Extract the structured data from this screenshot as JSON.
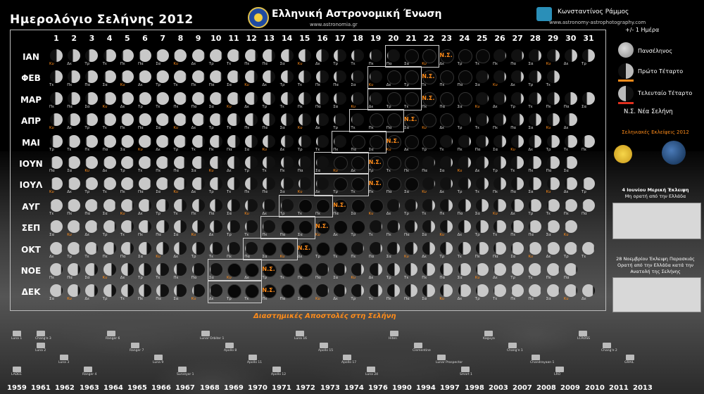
{
  "header": {
    "title": "Ημερολόγιο Σελήνης 2012",
    "org": "Ελληνική Αστρονομική Ένωση",
    "org_url": "www.astronomia.gr",
    "author": "Κωνσταντίνος Ράμμος",
    "author_url": "www.astronomy-astrophotography.com"
  },
  "months": [
    "ΙΑΝ",
    "ΦΕΒ",
    "ΜΑΡ",
    "ΑΠΡ",
    "ΜΑΙ",
    "ΙΟΥΝ",
    "ΙΟΥΛ",
    "ΑΥΓ",
    "ΣΕΠ",
    "ΟΚΤ",
    "ΝΟΕ",
    "ΔΕΚ"
  ],
  "days": [
    "1",
    "2",
    "3",
    "4",
    "5",
    "6",
    "7",
    "8",
    "9",
    "10",
    "11",
    "12",
    "13",
    "14",
    "15",
    "16",
    "17",
    "18",
    "19",
    "20",
    "21",
    "22",
    "23",
    "24",
    "25",
    "26",
    "27",
    "28",
    "29",
    "30",
    "31"
  ],
  "weekday_names": [
    "Κυ",
    "Δε",
    "Τρ",
    "Τε",
    "Πε",
    "Πα",
    "Σα"
  ],
  "month_lengths": [
    31,
    29,
    31,
    30,
    31,
    30,
    31,
    31,
    30,
    31,
    30,
    31
  ],
  "first_weekday": [
    0,
    3,
    4,
    0,
    2,
    5,
    0,
    3,
    6,
    1,
    4,
    6
  ],
  "new_moon_day": [
    23,
    22,
    22,
    21,
    20,
    19,
    19,
    17,
    16,
    15,
    13,
    13
  ],
  "new_moon_label": "Ν.Σ.",
  "legend": {
    "plus_minus": "+/- 1 Ημέρα",
    "full": "Πανσέληνος",
    "first_quarter": "Πρώτο Τέταρτο",
    "last_quarter": "Τελευταίο Τέταρτο",
    "new_moon": "Ν.Σ.  Νέα Σελήνη"
  },
  "eclipses": {
    "title": "Σεληνιακές Εκλείψεις  2012",
    "june_caption_1": "4 Ιουνίου Μερική Έκλειψη",
    "june_caption_2": "Μη ορατή από την Ελλάδα",
    "nov_caption_1": "28 Νοεμβρίου Έκλειψη Παρασκιάς",
    "nov_caption_2": "Ορατή από την Ελλάδα κατά την",
    "nov_caption_3": "Ανατολή της Σελήνης"
  },
  "missions": {
    "title": "Διαστημικές Αποστολές στη Σελήνη",
    "years": [
      "1959",
      "1961",
      "1962",
      "1963",
      "1964",
      "1965",
      "1966",
      "1967",
      "1968",
      "1969",
      "1970",
      "1971",
      "1972",
      "1973",
      "1974",
      "1976",
      "1990",
      "1994",
      "1997",
      "1998",
      "2003",
      "2007",
      "2008",
      "2009",
      "2010",
      "2011",
      "2013"
    ],
    "craft": [
      "Luna 1",
      "Luna 2",
      "Luna 3",
      "Ranger 4",
      "Ranger 6",
      "Ranger 7",
      "Luna 9",
      "Surveyor 1",
      "Lunar Orbiter 1",
      "Apollo 8",
      "Apollo 11",
      "Apollo 12",
      "Luna 16",
      "Apollo 15",
      "Apollo 17",
      "Luna 24",
      "Hiten",
      "Clementine",
      "Lunar Prospector",
      "Smart 1",
      "Kaguya",
      "Chang'e 1",
      "Chandrayaan 1",
      "LRO",
      "LCROSS",
      "Chang'e 2",
      "GRAIL",
      "LADEE",
      "Chang'e 3"
    ]
  },
  "colors": {
    "new_moon_box": "#cfcfcf",
    "accent_orange": "#ff8c1a",
    "full_marker": "#ffd400",
    "quarter_marker": "#e0301e"
  }
}
